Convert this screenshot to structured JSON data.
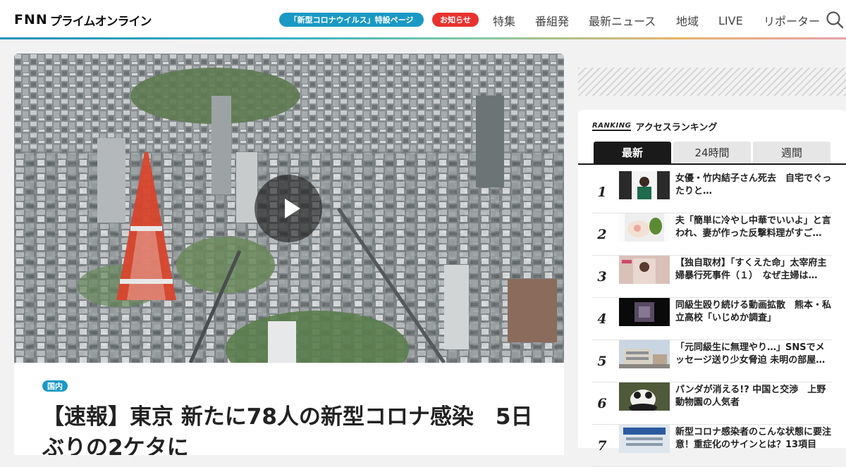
{
  "header": {
    "logo_brand": "FNN",
    "logo_sub": "プライムオンライン",
    "corona_pill": "「新型コロナウイルス」特設ページ",
    "news_pill": "お知らせ",
    "nav": [
      "特集",
      "番組発",
      "最新ニュース",
      "地域",
      "LIVE",
      "リポーター"
    ],
    "search_icon": "search-icon"
  },
  "article": {
    "category": "国内",
    "headline": "【速報】東京 新たに78人の新型コロナ感染　5日ぶりの2ケタに",
    "video": "play-icon"
  },
  "ranking": {
    "badge": "RANKING",
    "title": "アクセスランキング",
    "tabs": [
      "最新",
      "24時間",
      "週間"
    ],
    "active_tab": "最新",
    "items": [
      {
        "rank": "1",
        "text": "女優・竹内結子さん死去　自宅でぐったりと…"
      },
      {
        "rank": "2",
        "text": "夫「簡単に冷やし中華でいいよ」と言われ、妻が作った反撃料理がすご…"
      },
      {
        "rank": "3",
        "text": "【独自取材】「すくえた命」太宰府主婦暴行死事件（１）　なぜ主婦は…"
      },
      {
        "rank": "4",
        "text": "同級生殴り続ける動画拡散　熊本・私立高校「いじめか調査」"
      },
      {
        "rank": "5",
        "text": "「元同級生に無理やり…」SNSでメッセージ送り少女脅迫 未明の部屋…"
      },
      {
        "rank": "6",
        "text": "パンダが消える!? 中国と交渉　上野動物園の人気者"
      },
      {
        "rank": "7",
        "text": "新型コロナ感染者のこんな状態に要注意！重症化のサインとは？13項目"
      }
    ]
  },
  "colors": {
    "accent": "#1a99c4",
    "alert": "#e9322e",
    "dark": "#1a1a1a"
  }
}
